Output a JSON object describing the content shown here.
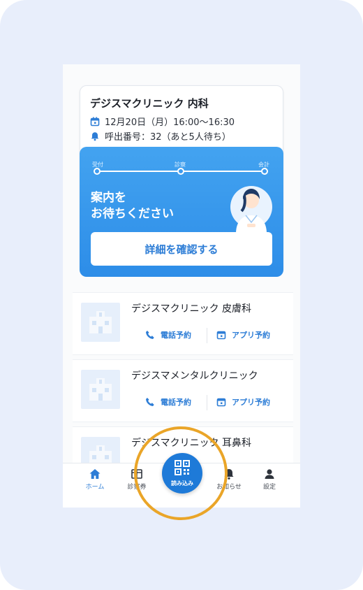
{
  "appointment": {
    "clinic_name": "デジスマクリニック 内科",
    "datetime": "12月20日（月）16:00〜16:30",
    "call_number": "呼出番号：32（あと5人待ち）"
  },
  "status_panel": {
    "steps": [
      "受付",
      "診察",
      "会計"
    ],
    "current_step": 2,
    "message": "案内を\nお待ちください",
    "detail_button": "詳細を確認する"
  },
  "clinics": [
    {
      "name": "デジスマクリニック 皮膚科",
      "phone_label": "電話予約",
      "app_label": "アプリ予約"
    },
    {
      "name": "デジスマメンタルクリニック",
      "phone_label": "電話予約",
      "app_label": "アプリ予約"
    },
    {
      "name": "デジスマクリニック 耳鼻科"
    }
  ],
  "tabbar": {
    "home": "ホーム",
    "ticket": "診察券",
    "qr": "読み込み",
    "notice": "お知らせ",
    "settings": "設定"
  },
  "colors": {
    "accent": "#2d7dd6",
    "panel": "#3e9bef",
    "qr_button": "#1e7ad8",
    "highlight": "#eaa528",
    "frame": "#e8eefb"
  }
}
